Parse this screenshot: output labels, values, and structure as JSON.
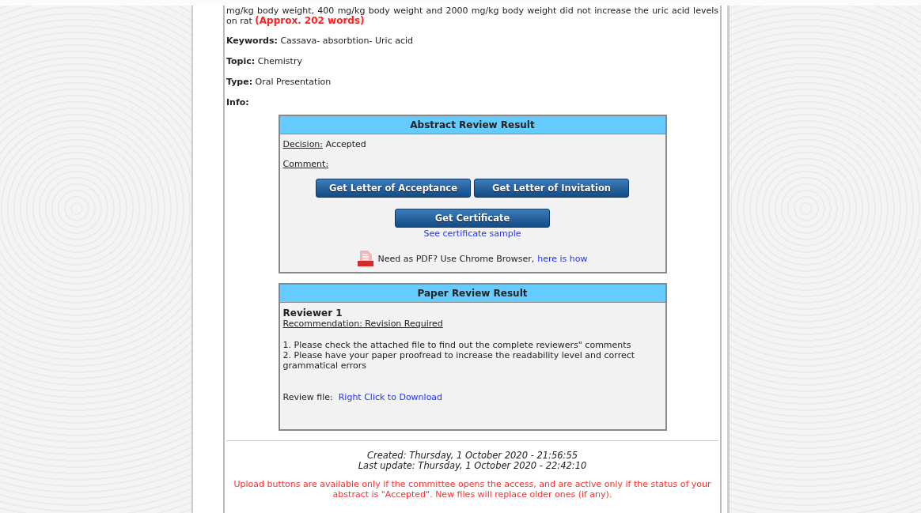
{
  "abstract": {
    "text": "mg/kg body weight, 400 mg/kg body weight and 2000 mg/kg body weight did not increase the uric acid levels on rat",
    "word_count": "(Approx. 202 words)"
  },
  "fields": [
    {
      "label": "Keywords:",
      "value": "Cassava- absorbtion- Uric acid"
    },
    {
      "label": "Topic:",
      "value": "Chemistry"
    },
    {
      "label": "Type:",
      "value": "Oral Presentation"
    },
    {
      "label": "Info:"
    }
  ],
  "abstract_review": {
    "title": "Abstract Review Result",
    "decision_label": "Decision:",
    "decision": "Accepted",
    "comment_label": "Comment:",
    "buttons": [
      "Get Letter of Acceptance",
      "Get Letter of Invitation"
    ],
    "certificate_button": "Get Certificate",
    "sample_link": "See certificate sample",
    "pdf_note": "Need as PDF? Use Chrome Browser,",
    "pdf_link": "here is how"
  },
  "paper_review": {
    "title": "Paper Review Result",
    "reviewers": [
      {
        "name": "Reviewer 1",
        "recommendation": "Recommendation: Revision Required",
        "comments": [
          "1. Please check the attached file to find out the complete reviewers\" comments",
          "2. Please have your paper proofread to increase the readability level and correct grammatical errors"
        ],
        "file_label": "Review file:",
        "file_link": "Right Click to Download"
      }
    ]
  },
  "footer": {
    "created": "Created: Thursday, 1 October 2020 - 21:56:55",
    "last_update": "Last update: Thursday, 1 October 2020 - 22:42:10",
    "notice": "Upload buttons are available only if the committee opens the access, and are active only if the status of your abstract is \"Accepted\". New files will replace older ones (if any)."
  }
}
